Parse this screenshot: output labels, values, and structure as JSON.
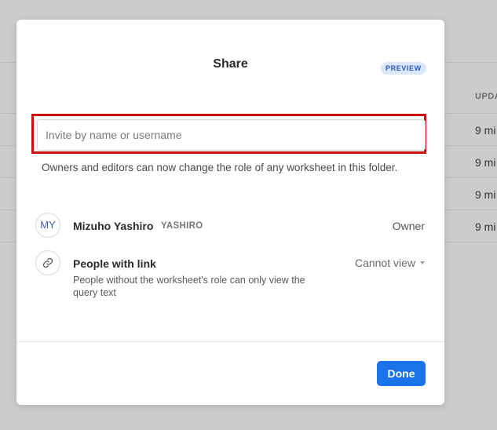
{
  "background": {
    "column_header": "UPDA",
    "rows": [
      "9 mi",
      "9 mi",
      "9 mi",
      "9 mi"
    ]
  },
  "modal": {
    "title": "Share",
    "badge": "PREVIEW",
    "invite": {
      "placeholder": "Invite by name or username",
      "value": ""
    },
    "notice": "Owners and editors can now change the role of any worksheet in this folder.",
    "members": [
      {
        "initials": "MY",
        "name": "Mizuho Yashiro",
        "handle": "YASHIRO",
        "role": "Owner"
      }
    ],
    "link_access": {
      "title": "People with link",
      "description": "People without the worksheet's role can only view the query text",
      "selected": "Cannot view"
    },
    "done_label": "Done"
  },
  "colors": {
    "accent": "#1a73e8",
    "highlight": "#cc1010",
    "badge_bg": "#dbe7fb",
    "badge_text": "#2c5ab8"
  },
  "icons": {
    "link": "link-icon",
    "dropdown": "caret-down-icon"
  }
}
